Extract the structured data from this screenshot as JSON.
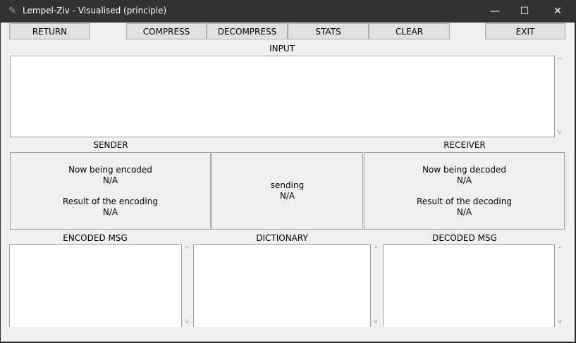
{
  "window": {
    "title": "Lempel-Ziv - Visualised (principle)",
    "minimize": "—",
    "maximize": "☐",
    "close": "✕"
  },
  "toolbar": {
    "return": "RETURN",
    "compress": "COMPRESS",
    "decompress": "DECOMPRESS",
    "stats": "STATS",
    "clear": "CLEAR",
    "exit": "EXIT"
  },
  "labels": {
    "input": "INPUT",
    "sender": "SENDER",
    "receiver": "RECEIVER",
    "encoded": "ENCODED MSG",
    "dictionary": "DICTIONARY",
    "decoded": "DECODED MSG"
  },
  "sender": {
    "now_label": "Now being encoded",
    "now_value": "N/A",
    "result_label": "Result of the encoding",
    "result_value": "N/A"
  },
  "channel": {
    "label": "sending",
    "value": "N/A"
  },
  "receiver": {
    "now_label": "Now being decoded",
    "now_value": "N/A",
    "result_label": "Result of the decoding",
    "result_value": "N/A"
  },
  "scroll": {
    "up": "^",
    "down": "v"
  }
}
